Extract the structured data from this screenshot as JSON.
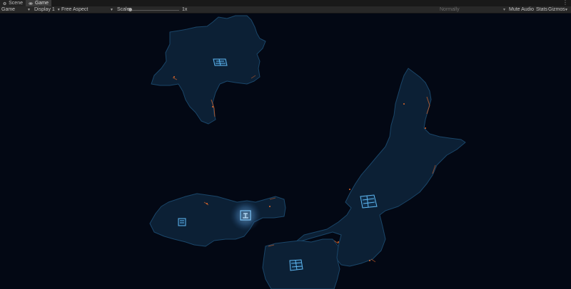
{
  "tabs": [
    {
      "label": "Scene",
      "icon": "scene-icon",
      "active": false
    },
    {
      "label": "Game",
      "icon": "game-icon",
      "active": true
    }
  ],
  "window_menu_glyph": "⋮",
  "toolbar": {
    "view_dropdown": "Game",
    "display_dropdown": "Display 1",
    "aspect_dropdown": "Free Aspect",
    "scale_label": "Scale",
    "scale_value": "1x",
    "play_mode_dropdown": "Normally",
    "mute_audio": "Mute Audio",
    "stats": "Stats",
    "gizmos": "Gizmos"
  },
  "colors": {
    "editor_bg": "#191919",
    "toolbar_bg": "#282828",
    "viewport_bg": "#030814",
    "island_fill": "#0c2035",
    "island_edge": "#1a4669",
    "ember_orange": "#e0682a",
    "icon_cyan": "#5fb8f2"
  }
}
